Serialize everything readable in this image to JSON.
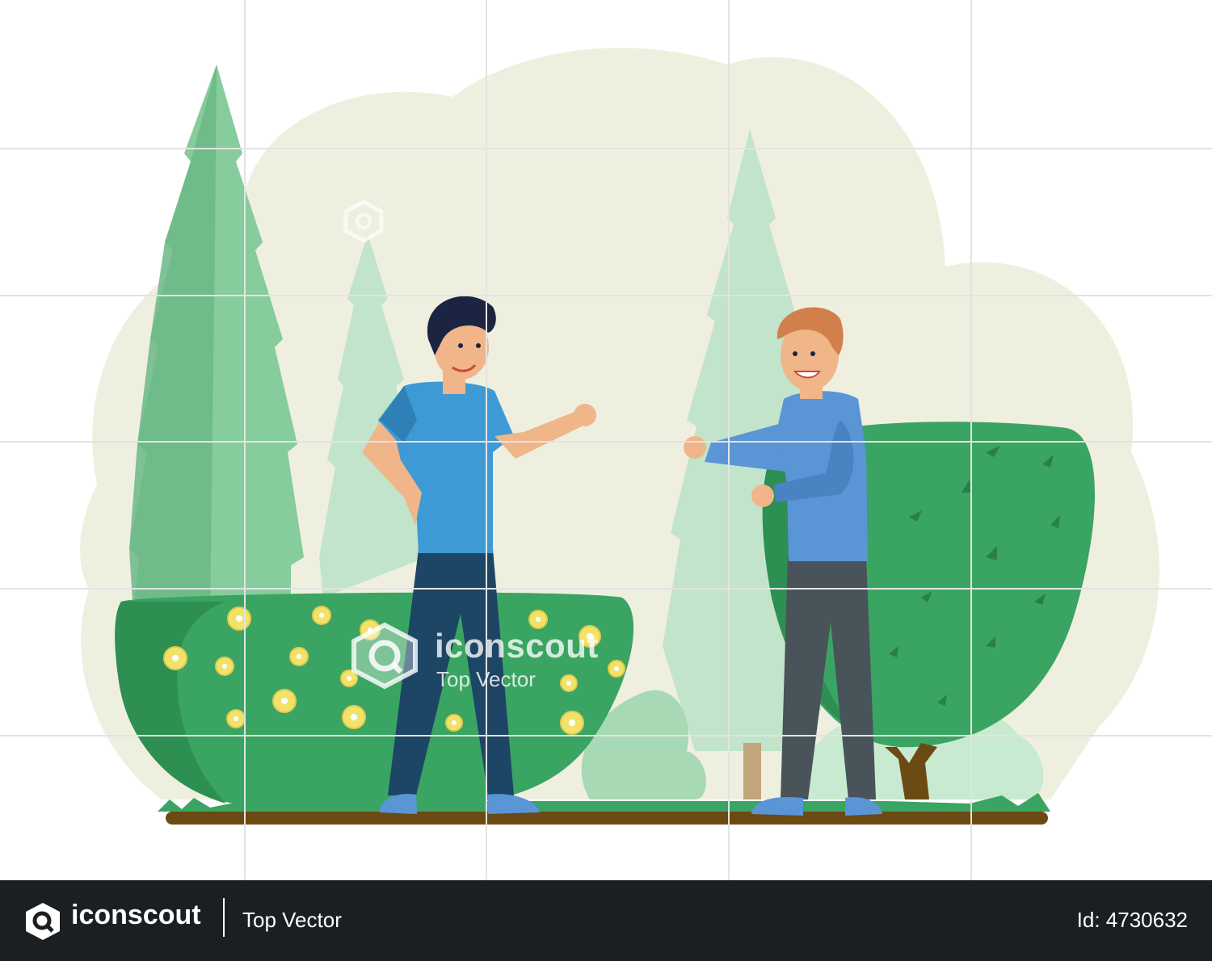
{
  "illustration": {
    "subject": "two-men-fist-bump-in-park",
    "colors": {
      "background_blob": "#efefe0",
      "tree_light": "#c2e4ca",
      "tree_mid": "#86cc9d",
      "bush_dark": "#3aa462",
      "flower": "#f1e26a",
      "shirt_man1": "#3e9ad4",
      "shirt_man2": "#5a95d6",
      "pants_man1": "#1c4566",
      "pants_man2": "#48535a",
      "ground": "#6b4a13",
      "grass": "#3aa462"
    }
  },
  "watermark": {
    "brand": "iconscout",
    "subtitle": "Top Vector"
  },
  "footer": {
    "brand": "iconscout",
    "tag": "Top Vector",
    "asset_id": "Id: 4730632"
  }
}
